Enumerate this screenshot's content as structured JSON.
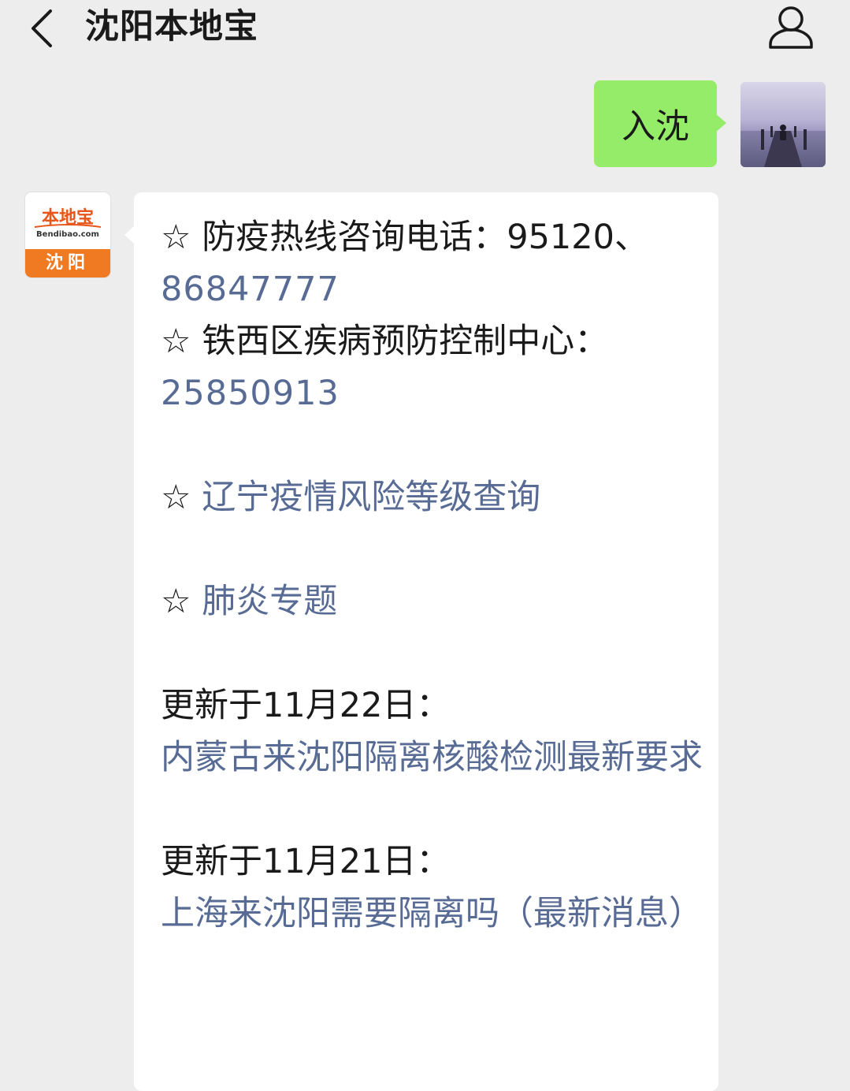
{
  "header": {
    "title": "沈阳本地宝"
  },
  "outgoing_message": {
    "text": "入沈"
  },
  "bot_avatar": {
    "logo_text": "本地宝",
    "logo_url": "Bendibao.com",
    "city": "沈阳"
  },
  "reply": {
    "hotline_label": "☆ 防疫热线咨询电话：95120、",
    "hotline_number": "86847777",
    "cdc_label": "☆ 铁西区疾病预防控制中心：",
    "cdc_number": "25850913",
    "star1": "☆ ",
    "risk_link": "辽宁疫情风险等级查询",
    "star2": "☆ ",
    "topic_link": "肺炎专题",
    "update1_label": "更新于11月22日：",
    "update1_link": "内蒙古来沈阳隔离核酸检测最新要求",
    "update2_label": "更新于11月21日：",
    "update2_link": "上海来沈阳需要隔离吗（最新消息）"
  }
}
